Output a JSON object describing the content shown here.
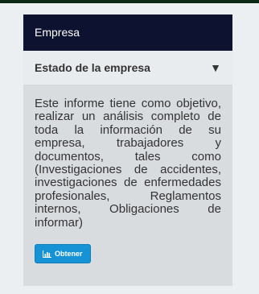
{
  "panel": {
    "title": "Empresa"
  },
  "section": {
    "title": "Estado de la empresa",
    "toggle_icon": "triangle-down-icon",
    "description": "Este informe tiene como objetivo, realizar un análisis completo de toda la información de su empresa, trabajadores y documentos, tales como (Investigaciones de accidentes, investigaciones de enfermedades profesionales, Reglamentos internos, Obligaciones de informar)",
    "button_label": "Obtener",
    "button_icon": "bar-chart-icon"
  },
  "colors": {
    "header_bg": "#0c1230",
    "body_bg": "#d8dcdf",
    "button_bg": "#1693d6"
  }
}
